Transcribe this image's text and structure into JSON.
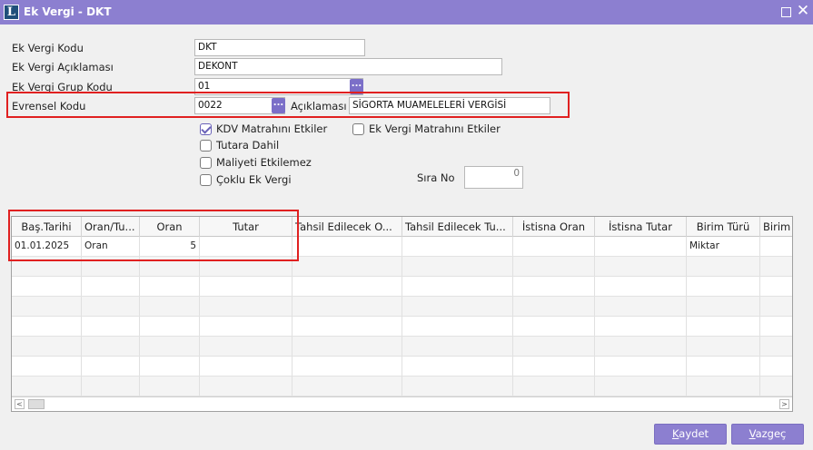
{
  "window": {
    "logo_letter": "L",
    "title": "Ek Vergi - DKT",
    "maximize_icon": "maximize-icon",
    "close_icon": "close-icon",
    "close_glyph": "✕"
  },
  "form": {
    "ek_vergi_kodu": {
      "label": "Ek Vergi Kodu",
      "value": "DKT"
    },
    "ek_vergi_aciklamasi": {
      "label": "Ek Vergi Açıklaması",
      "value": "DEKONT"
    },
    "ek_vergi_grup_kodu": {
      "label": "Ek Vergi Grup Kodu",
      "value": "01"
    },
    "evrensel_kodu": {
      "label": "Evrensel Kodu",
      "value": "0022"
    },
    "aciklamasi": {
      "label": "Açıklaması",
      "value": "SİGORTA MUAMELELERİ VERGİSİ"
    },
    "lookup_glyph": "..."
  },
  "checkboxes": {
    "kdv_matrahini_etkiler": {
      "label": "KDV Matrahını Etkiler",
      "checked": true
    },
    "ek_vergi_matrahini_etkiler": {
      "label": "Ek Vergi Matrahını Etkiler",
      "checked": false
    },
    "tutara_dahil": {
      "label": "Tutara Dahil",
      "checked": false
    },
    "maliyeti_etkilemez": {
      "label": "Maliyeti Etkilemez",
      "checked": false
    },
    "coklu_ek_vergi": {
      "label": "Çoklu Ek Vergi",
      "checked": false
    }
  },
  "sira_no": {
    "label": "Sıra No",
    "value": "0"
  },
  "grid": {
    "columns": [
      "Baş.Tarihi",
      "Oran/Tu...",
      "Oran",
      "Tutar",
      "Tahsil Edilecek O...",
      "Tahsil Edilecek Tu...",
      "İstisna Oran",
      "İstisna Tutar",
      "Birim Türü",
      "Birim"
    ],
    "rows": [
      [
        "01.01.2025",
        "Oran",
        "5",
        "",
        "",
        "",
        "",
        "",
        "Miktar",
        ""
      ]
    ]
  },
  "scroll": {
    "left_glyph": "<",
    "right_glyph": ">"
  },
  "buttons": {
    "kaydet": {
      "mnemonic": "K",
      "rest": "aydet"
    },
    "vazgec": {
      "mnemonic": "V",
      "rest": "azgeç"
    }
  },
  "colors": {
    "accent": "#8c7fd0",
    "highlight": "#e02020"
  }
}
